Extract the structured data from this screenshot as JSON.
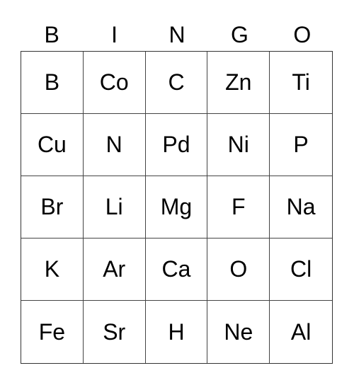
{
  "header": [
    "B",
    "I",
    "N",
    "G",
    "O"
  ],
  "cells": [
    [
      "B",
      "Co",
      "C",
      "Zn",
      "Ti"
    ],
    [
      "Cu",
      "N",
      "Pd",
      "Ni",
      "P"
    ],
    [
      "Br",
      "Li",
      "Mg",
      "F",
      "Na"
    ],
    [
      "K",
      "Ar",
      "Ca",
      "O",
      "Cl"
    ],
    [
      "Fe",
      "Sr",
      "H",
      "Ne",
      "Al"
    ]
  ]
}
